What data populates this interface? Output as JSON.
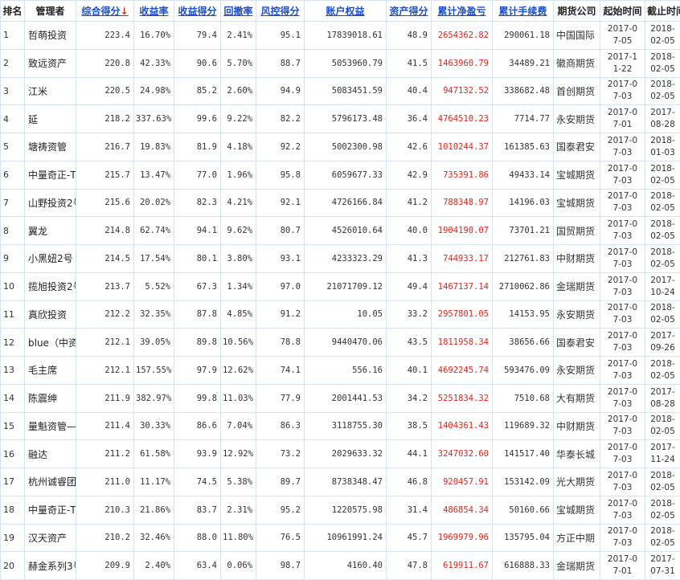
{
  "headers": {
    "rank": "排名",
    "manager": "管理者",
    "total_score": "综合得分",
    "return_rate": "收益率",
    "return_score": "收益得分",
    "drawdown": "回撤率",
    "risk_score": "风控得分",
    "equity": "账户权益",
    "asset_score": "资产得分",
    "cum_pnl": "累计净盈亏",
    "cum_fee": "累计手续费",
    "broker": "期货公司",
    "start": "起始时间",
    "end": "截止时间"
  },
  "sort_indicator": "↓",
  "colors": {
    "link": "#1a4fd0",
    "profit": "#e0261e",
    "grid": "#d9e3ee"
  },
  "rows": [
    {
      "rank": "1",
      "manager": "哲萌投资",
      "total": "223.4",
      "ret": "16.70%",
      "ret_score": "79.4",
      "dd": "2.41%",
      "risk": "95.1",
      "equity": "17839018.61",
      "asset": "48.9",
      "pnl": "2654362.82",
      "fee": "290061.18",
      "broker": "中国国际",
      "start": "2017-07-05",
      "end": "2018-02-05"
    },
    {
      "rank": "2",
      "manager": "致远资产",
      "total": "220.8",
      "ret": "42.33%",
      "ret_score": "90.6",
      "dd": "5.70%",
      "risk": "88.7",
      "equity": "5053960.79",
      "asset": "41.5",
      "pnl": "1463960.79",
      "fee": "34489.21",
      "broker": "徽商期货",
      "start": "2017-11-22",
      "end": "2018-02-05"
    },
    {
      "rank": "3",
      "manager": "江米",
      "total": "220.5",
      "ret": "24.98%",
      "ret_score": "85.2",
      "dd": "2.60%",
      "risk": "94.9",
      "equity": "5083451.59",
      "asset": "40.4",
      "pnl": "947132.52",
      "fee": "338682.48",
      "broker": "首创期货",
      "start": "2017-07-03",
      "end": "2018-02-05"
    },
    {
      "rank": "4",
      "manager": "延",
      "total": "218.2",
      "ret": "337.63%",
      "ret_score": "99.6",
      "dd": "9.22%",
      "risk": "82.2",
      "equity": "5796173.48",
      "asset": "36.4",
      "pnl": "4764510.23",
      "fee": "7714.77",
      "broker": "永安期货",
      "start": "2017-07-01",
      "end": "2017-08-28"
    },
    {
      "rank": "5",
      "manager": "塘祷资管",
      "total": "216.7",
      "ret": "19.83%",
      "ret_score": "81.9",
      "dd": "4.18%",
      "risk": "92.2",
      "equity": "5002300.98",
      "asset": "42.6",
      "pnl": "1010244.37",
      "fee": "161385.63",
      "broker": "国泰君安",
      "start": "2017-07-03",
      "end": "2018-01-03"
    },
    {
      "rank": "6",
      "manager": "中量奇正-T",
      "total": "215.7",
      "ret": "13.47%",
      "ret_score": "77.0",
      "dd": "1.96%",
      "risk": "95.8",
      "equity": "6059677.33",
      "asset": "42.9",
      "pnl": "735391.86",
      "fee": "49433.14",
      "broker": "宝城期货",
      "start": "2017-07-03",
      "end": "2018-02-05"
    },
    {
      "rank": "7",
      "manager": "山野投资2号",
      "total": "215.6",
      "ret": "20.02%",
      "ret_score": "82.3",
      "dd": "4.21%",
      "risk": "92.1",
      "equity": "4726166.84",
      "asset": "41.2",
      "pnl": "788348.97",
      "fee": "14196.03",
      "broker": "宝城期货",
      "start": "2017-07-03",
      "end": "2018-02-05"
    },
    {
      "rank": "8",
      "manager": "翼龙",
      "total": "214.8",
      "ret": "62.74%",
      "ret_score": "94.1",
      "dd": "9.62%",
      "risk": "80.7",
      "equity": "4526010.64",
      "asset": "40.0",
      "pnl": "1904190.07",
      "fee": "73701.21",
      "broker": "国贸期货",
      "start": "2017-07-03",
      "end": "2018-02-05"
    },
    {
      "rank": "9",
      "manager": "小黑妞2号",
      "total": "214.5",
      "ret": "17.54%",
      "ret_score": "80.1",
      "dd": "3.80%",
      "risk": "93.1",
      "equity": "4233323.29",
      "asset": "41.3",
      "pnl": "744933.17",
      "fee": "212761.83",
      "broker": "中财期货",
      "start": "2017-07-03",
      "end": "2018-02-05"
    },
    {
      "rank": "10",
      "manager": "揽旭投资2号",
      "total": "213.7",
      "ret": "5.52%",
      "ret_score": "67.3",
      "dd": "1.34%",
      "risk": "97.0",
      "equity": "21071709.12",
      "asset": "49.4",
      "pnl": "1467137.14",
      "fee": "2710062.86",
      "broker": "金瑞期货",
      "start": "2017-07-03",
      "end": "2017-10-24"
    },
    {
      "rank": "11",
      "manager": "真欣投资",
      "total": "212.2",
      "ret": "32.35%",
      "ret_score": "87.8",
      "dd": "4.85%",
      "risk": "91.2",
      "equity": "10.05",
      "asset": "33.2",
      "pnl": "2957801.05",
      "fee": "14153.95",
      "broker": "永安期货",
      "start": "2017-07-03",
      "end": "2018-02-05"
    },
    {
      "rank": "12",
      "manager": "blue（中资",
      "total": "212.1",
      "ret": "39.05%",
      "ret_score": "89.8",
      "dd": "10.56%",
      "risk": "78.8",
      "equity": "9440470.06",
      "asset": "43.5",
      "pnl": "1811958.34",
      "fee": "38656.66",
      "broker": "国泰君安",
      "start": "2017-07-03",
      "end": "2017-09-26"
    },
    {
      "rank": "13",
      "manager": "毛主席",
      "total": "212.1",
      "ret": "157.55%",
      "ret_score": "97.9",
      "dd": "12.62%",
      "risk": "74.1",
      "equity": "556.16",
      "asset": "40.1",
      "pnl": "4692245.74",
      "fee": "593476.09",
      "broker": "永安期货",
      "start": "2017-07-03",
      "end": "2018-02-05"
    },
    {
      "rank": "14",
      "manager": "陈震绅",
      "total": "211.9",
      "ret": "382.97%",
      "ret_score": "99.8",
      "dd": "11.03%",
      "risk": "77.9",
      "equity": "2001441.53",
      "asset": "34.2",
      "pnl": "5251834.32",
      "fee": "7510.68",
      "broker": "大有期货",
      "start": "2017-07-03",
      "end": "2017-08-28"
    },
    {
      "rank": "15",
      "manager": "量魁资管—",
      "total": "211.4",
      "ret": "30.33%",
      "ret_score": "86.6",
      "dd": "7.04%",
      "risk": "86.3",
      "equity": "3118755.30",
      "asset": "38.5",
      "pnl": "1404361.43",
      "fee": "119689.32",
      "broker": "中财期货",
      "start": "2017-07-03",
      "end": "2018-02-05"
    },
    {
      "rank": "16",
      "manager": "融达",
      "total": "211.2",
      "ret": "61.58%",
      "ret_score": "93.9",
      "dd": "12.92%",
      "risk": "73.2",
      "equity": "2029633.32",
      "asset": "44.1",
      "pnl": "3247032.60",
      "fee": "141517.40",
      "broker": "华泰长城",
      "start": "2017-07-03",
      "end": "2017-11-24"
    },
    {
      "rank": "17",
      "manager": "杭州诚睿团",
      "total": "211.0",
      "ret": "11.17%",
      "ret_score": "74.5",
      "dd": "5.38%",
      "risk": "89.7",
      "equity": "8738348.47",
      "asset": "46.8",
      "pnl": "920457.91",
      "fee": "153142.09",
      "broker": "光大期货",
      "start": "2017-07-03",
      "end": "2018-02-05"
    },
    {
      "rank": "18",
      "manager": "中量奇正-T",
      "total": "210.3",
      "ret": "21.86%",
      "ret_score": "83.7",
      "dd": "2.31%",
      "risk": "95.2",
      "equity": "1220575.98",
      "asset": "31.4",
      "pnl": "486854.34",
      "fee": "50160.66",
      "broker": "宝城期货",
      "start": "2017-07-03",
      "end": "2018-02-05"
    },
    {
      "rank": "19",
      "manager": "汉天资产",
      "total": "210.2",
      "ret": "32.46%",
      "ret_score": "88.0",
      "dd": "11.80%",
      "risk": "76.5",
      "equity": "10961991.24",
      "asset": "45.7",
      "pnl": "1969979.96",
      "fee": "135795.04",
      "broker": "方正中期",
      "start": "2017-07-03",
      "end": "2018-02-05"
    },
    {
      "rank": "20",
      "manager": "赫金系列3号",
      "total": "209.9",
      "ret": "2.40%",
      "ret_score": "63.4",
      "dd": "0.06%",
      "risk": "98.7",
      "equity": "4160.40",
      "asset": "47.8",
      "pnl": "619911.67",
      "fee": "616888.33",
      "broker": "金瑞期货",
      "start": "2017-07-01",
      "end": "2017-07-31"
    }
  ]
}
